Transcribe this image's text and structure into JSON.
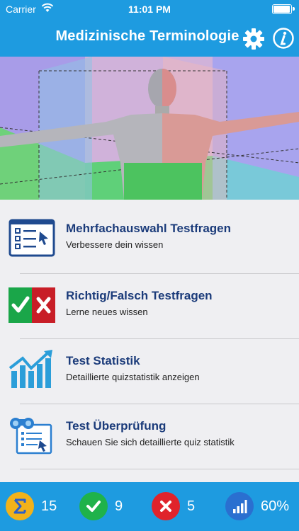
{
  "status_bar": {
    "carrier": "Carrier",
    "time": "11:01 PM"
  },
  "header": {
    "title": "Medizinische Terminologie"
  },
  "menu": [
    {
      "title": "Mehrfachauswahl Testfragen",
      "subtitle": "Verbessere dein wissen",
      "icon": "checklist-icon"
    },
    {
      "title": "Richtig/Falsch Testfragen",
      "subtitle": "Lerne neues wissen",
      "icon": "true-false-icon"
    },
    {
      "title": "Test Statistik",
      "subtitle": "Detaillierte quizstatistik anzeigen",
      "icon": "statistics-chart-icon"
    },
    {
      "title": "Test Überprüfung",
      "subtitle": "Schauen Sie sich detaillierte quiz statistik",
      "icon": "review-binoculars-icon"
    }
  ],
  "footer": {
    "total": "15",
    "correct": "9",
    "wrong": "5",
    "percent": "60%"
  },
  "colors": {
    "header": "#1e9be0",
    "title_text": "#1b3b7a",
    "total_badge": "#f2b21a",
    "correct_badge": "#1fb24a",
    "wrong_badge": "#e0232b",
    "percent_badge": "#2a6fd0"
  }
}
